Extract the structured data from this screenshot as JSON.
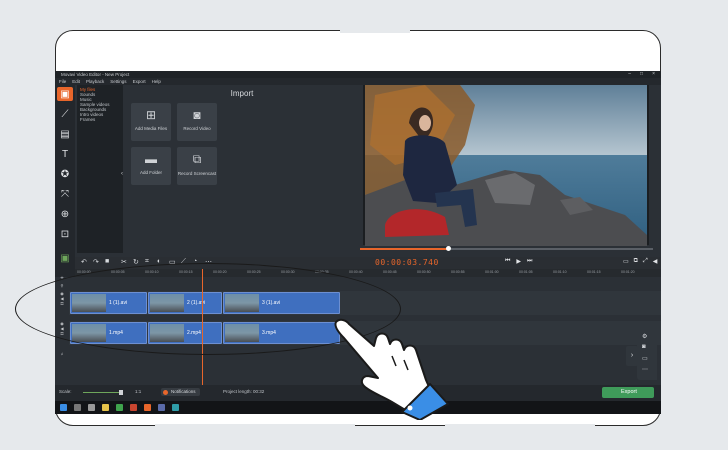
{
  "app": {
    "title": "Movavi Video Editor - New Project",
    "window_controls": [
      "–",
      "□",
      "×"
    ]
  },
  "menu": [
    "File",
    "Edit",
    "Playback",
    "Settings",
    "Export",
    "Help"
  ],
  "sidebar": {
    "tools": [
      {
        "name": "import-tool",
        "icon": "film-icon"
      },
      {
        "name": "filters-tool",
        "icon": "wand-icon"
      },
      {
        "name": "transitions-tool",
        "icon": "transition-icon"
      },
      {
        "name": "titles-tool",
        "icon": "text-icon"
      },
      {
        "name": "stickers-tool",
        "icon": "sticker-icon"
      },
      {
        "name": "callouts-tool",
        "icon": "callout-icon"
      },
      {
        "name": "zoom-tool",
        "icon": "magnify-icon"
      },
      {
        "name": "more-tools",
        "icon": "more-icon"
      }
    ]
  },
  "import": {
    "title": "Import",
    "categories": [
      "My files",
      "Sounds",
      "Music",
      "Sample videos",
      "Backgrounds",
      "Intro videos",
      "Frames"
    ],
    "tiles": [
      {
        "label": "Add Media Files",
        "icon": "add-media-icon"
      },
      {
        "label": "Record Video",
        "icon": "camera-icon"
      },
      {
        "label": "Add Folder",
        "icon": "folder-icon"
      },
      {
        "label": "Record Screencast",
        "icon": "screencast-icon"
      }
    ]
  },
  "player": {
    "timecode": "00:00:03.740",
    "progress": 0.3
  },
  "timeline": {
    "ruler_ticks": [
      "00:00:00",
      "00:00:05",
      "00:00:10",
      "00:00:15",
      "00:00:20",
      "00:00:25",
      "00:00:30",
      "00:00:35",
      "00:00:40",
      "00:00:45",
      "00:00:50",
      "00:00:55",
      "00:01:00",
      "00:01:05",
      "00:01:10",
      "00:01:15",
      "00:01:20"
    ],
    "audio_track": [
      "1 (1).avi",
      "2 (1).avi",
      "3 (1).avi"
    ],
    "video_track": [
      "1.mp4",
      "2.mp4",
      "3.mp4"
    ]
  },
  "status": {
    "scale_label": "Scale:",
    "zoom_value": "1:1",
    "notifications": "Notifications",
    "project_length": "Project length: 00:32",
    "export_label": "Export"
  },
  "colors": {
    "accent": "#e8662b",
    "clip": "#3f6fbf",
    "export": "#3f9b5a"
  }
}
